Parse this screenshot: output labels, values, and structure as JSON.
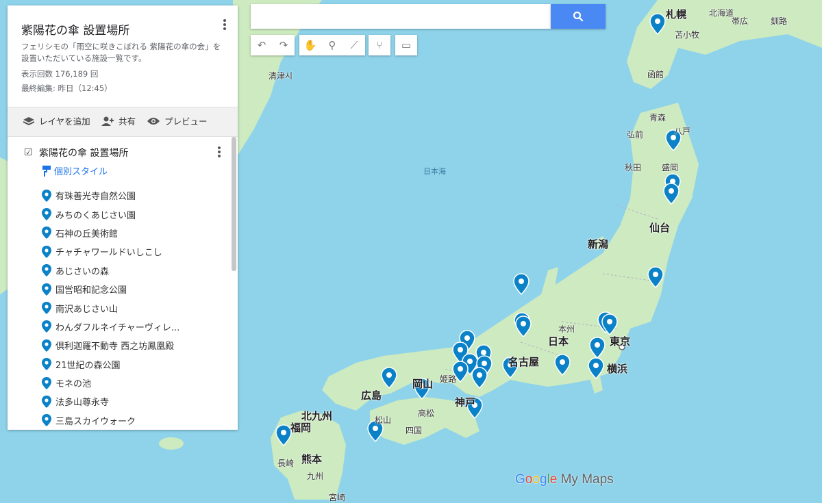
{
  "panel": {
    "title": "紫陽花の傘 設置場所",
    "description": "フェリシモの「雨空に咲きこぼれる 紫陽花の傘の会」を設置いただいている施設一覧です。",
    "view_count": "表示回数 176,189 回",
    "last_edit": "最終編集: 昨日（12:45）",
    "actions": {
      "add_layer": "レイヤを追加",
      "share": "共有",
      "preview": "プレビュー"
    },
    "layer": {
      "title": "紫陽花の傘 設置場所",
      "style_link": "個別スタイル",
      "items": [
        "有珠善光寺自然公園",
        "みちのくあじさい園",
        "石神の丘美術館",
        "チャチャワールドいしこし",
        "あじさいの森",
        "国営昭和記念公園",
        "南沢あじさい山",
        "わんダフルネイチャーヴィレ...",
        "倶利迦羅不動寺 西之坊鳳凰殿",
        "21世紀の森公園",
        "モネの池",
        "法多山尊永寺",
        "三島スカイウォーク"
      ]
    }
  },
  "search": {
    "placeholder": ""
  },
  "tools": [
    "undo-icon",
    "redo-icon",
    "hand-icon",
    "marker-icon",
    "line-icon",
    "directions-icon",
    "ruler-icon"
  ],
  "map": {
    "places": [
      {
        "name": "札幌",
        "type": "big"
      },
      {
        "name": "北海道"
      },
      {
        "name": "帯広"
      },
      {
        "name": "釧路"
      },
      {
        "name": "苫小牧"
      },
      {
        "name": "函館"
      },
      {
        "name": "清津시"
      },
      {
        "name": "青森"
      },
      {
        "name": "弘前"
      },
      {
        "name": "八戸"
      },
      {
        "name": "秋田"
      },
      {
        "name": "盛岡"
      },
      {
        "name": "仙台",
        "type": "big"
      },
      {
        "name": "新潟",
        "type": "big"
      },
      {
        "name": "日本海",
        "type": "sea"
      },
      {
        "name": "本州"
      },
      {
        "name": "日本",
        "type": "big"
      },
      {
        "name": "東京",
        "type": "big"
      },
      {
        "name": "横浜",
        "type": "big"
      },
      {
        "name": "名古屋",
        "type": "big"
      },
      {
        "name": "姫路"
      },
      {
        "name": "岡山",
        "type": "big"
      },
      {
        "name": "広島",
        "type": "big"
      },
      {
        "name": "神戸",
        "type": "big"
      },
      {
        "name": "高松"
      },
      {
        "name": "松山"
      },
      {
        "name": "四国"
      },
      {
        "name": "北九州",
        "type": "big"
      },
      {
        "name": "福岡",
        "type": "big"
      },
      {
        "name": "熊本",
        "type": "big"
      },
      {
        "name": "長崎"
      },
      {
        "name": "九州"
      },
      {
        "name": "宮崎"
      }
    ],
    "pin_color": "#0b82c8",
    "land_color": "#cdeac0",
    "water_color": "#8fd3ea"
  },
  "branding": {
    "logo_google": "Google",
    "logo_mymaps": "My Maps"
  }
}
